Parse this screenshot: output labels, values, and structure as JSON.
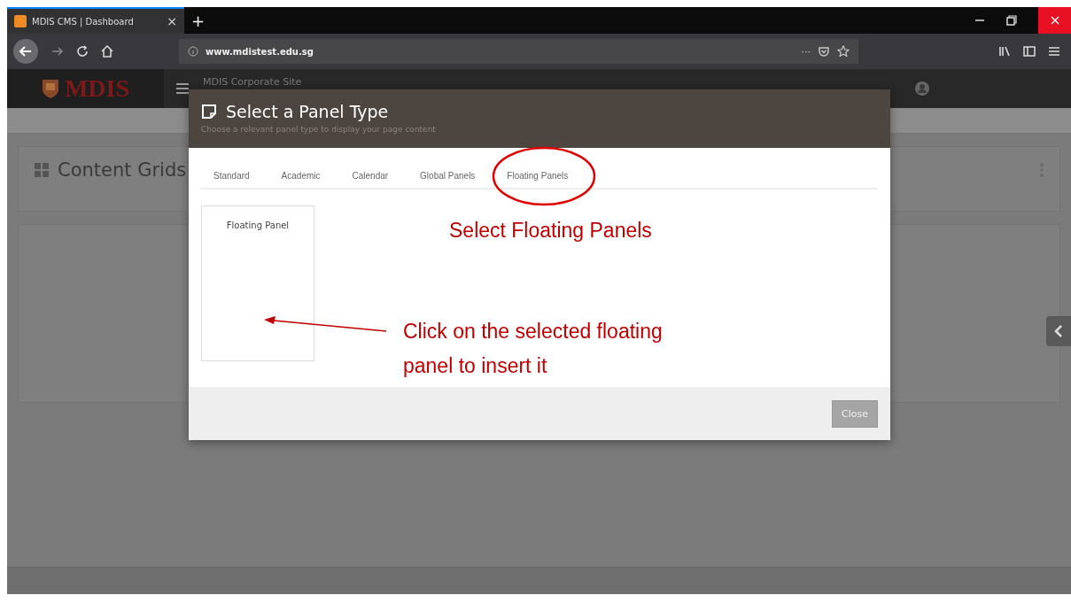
{
  "browser": {
    "tab_title": "MDIS CMS | Dashboard",
    "tab_close": "×",
    "new_tab": "+",
    "url_domain": "www.mdistest.edu.sg",
    "url_more": "···"
  },
  "app": {
    "logo": "MDIS",
    "site_name": "MDIS Corporate Site"
  },
  "page": {
    "title": "Content Grids"
  },
  "modal": {
    "title": "Select a Panel Type",
    "subtitle": "Choose a relevant panel type to display your page content",
    "tabs": [
      {
        "label": "Standard"
      },
      {
        "label": "Academic"
      },
      {
        "label": "Calendar"
      },
      {
        "label": "Global Panels"
      },
      {
        "label": "Floating Panels"
      }
    ],
    "panels": [
      {
        "label": "Floating Panel"
      }
    ],
    "close_button": "Close"
  },
  "annotations": [
    {
      "kind": "ellipse",
      "text": "Select Floating Panels"
    },
    {
      "kind": "arrow",
      "text": "Click on the selected floating panel to insert it"
    }
  ]
}
